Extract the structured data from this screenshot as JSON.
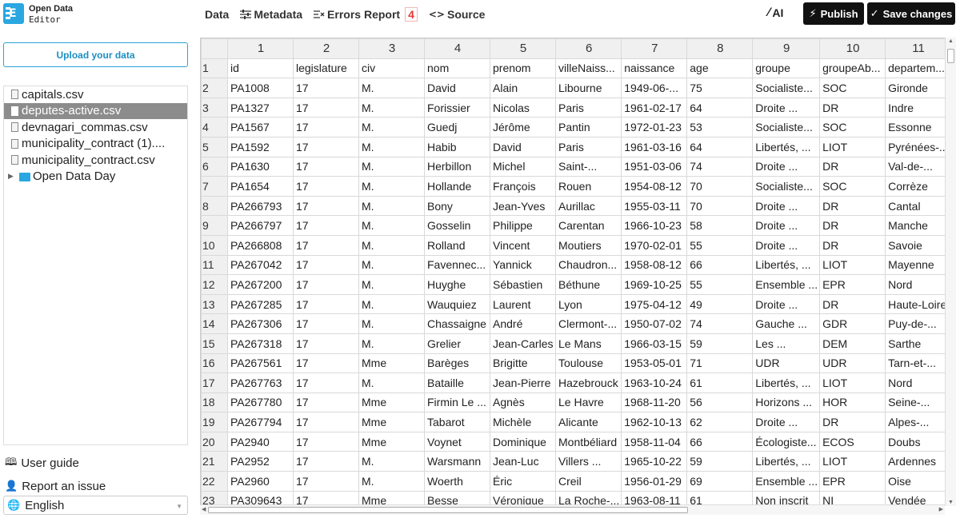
{
  "app": {
    "name_line1": "Open Data",
    "name_line2": "Editor"
  },
  "nav": {
    "data": "Data",
    "metadata": "Metadata",
    "errors_report": "Errors Report",
    "errors_count": "4",
    "source": "Source",
    "ai": "AI",
    "publish": "Publish",
    "save": "Save changes"
  },
  "sidebar": {
    "upload": "Upload your data",
    "files": [
      "capitals.csv",
      "deputes-active.csv",
      "devnagari_commas.csv",
      "municipality_contract (1)....",
      "municipality_contract.csv"
    ],
    "selected_index": 1,
    "folder": "Open Data Day",
    "user_guide": "User guide",
    "report_issue": "Report an issue",
    "language": "English"
  },
  "grid": {
    "col_numbers": [
      "1",
      "2",
      "3",
      "4",
      "5",
      "6",
      "7",
      "8",
      "9",
      "10",
      "11"
    ],
    "rows": [
      [
        "1",
        "id",
        "legislature",
        "civ",
        "nom",
        "prenom",
        "villeNaiss...",
        "naissance",
        "age",
        "groupe",
        "groupeAb...",
        "departem..."
      ],
      [
        "2",
        "PA1008",
        "17",
        "M.",
        "David",
        "Alain",
        "Libourne",
        "1949-06-...",
        "75",
        "Socialiste...",
        "SOC",
        "Gironde"
      ],
      [
        "3",
        "PA1327",
        "17",
        "M.",
        "Forissier",
        "Nicolas",
        "Paris",
        "1961-02-17",
        "64",
        "Droite ...",
        "DR",
        "Indre"
      ],
      [
        "4",
        "PA1567",
        "17",
        "M.",
        "Guedj",
        "Jérôme",
        "Pantin",
        "1972-01-23",
        "53",
        "Socialiste...",
        "SOC",
        "Essonne"
      ],
      [
        "5",
        "PA1592",
        "17",
        "M.",
        "Habib",
        "David",
        "Paris",
        "1961-03-16",
        "64",
        "Libertés, ...",
        "LIOT",
        "Pyrénées-..."
      ],
      [
        "6",
        "PA1630",
        "17",
        "M.",
        "Herbillon",
        "Michel",
        "Saint-...",
        "1951-03-06",
        "74",
        "Droite ...",
        "DR",
        "Val-de-..."
      ],
      [
        "7",
        "PA1654",
        "17",
        "M.",
        "Hollande",
        "François",
        "Rouen",
        "1954-08-12",
        "70",
        "Socialiste...",
        "SOC",
        "Corrèze"
      ],
      [
        "8",
        "PA266793",
        "17",
        "M.",
        "Bony",
        "Jean-Yves",
        "Aurillac",
        "1955-03-11",
        "70",
        "Droite ...",
        "DR",
        "Cantal"
      ],
      [
        "9",
        "PA266797",
        "17",
        "M.",
        "Gosselin",
        "Philippe",
        "Carentan",
        "1966-10-23",
        "58",
        "Droite ...",
        "DR",
        "Manche"
      ],
      [
        "10",
        "PA266808",
        "17",
        "M.",
        "Rolland",
        "Vincent",
        "Moutiers",
        "1970-02-01",
        "55",
        "Droite ...",
        "DR",
        "Savoie"
      ],
      [
        "11",
        "PA267042",
        "17",
        "M.",
        "Favennec...",
        "Yannick",
        "Chaudron...",
        "1958-08-12",
        "66",
        "Libertés, ...",
        "LIOT",
        "Mayenne"
      ],
      [
        "12",
        "PA267200",
        "17",
        "M.",
        "Huyghe",
        "Sébastien",
        "Béthune",
        "1969-10-25",
        "55",
        "Ensemble ...",
        "EPR",
        "Nord"
      ],
      [
        "13",
        "PA267285",
        "17",
        "M.",
        "Wauquiez",
        "Laurent",
        "Lyon",
        "1975-04-12",
        "49",
        "Droite ...",
        "DR",
        "Haute-Loire"
      ],
      [
        "14",
        "PA267306",
        "17",
        "M.",
        "Chassaigne",
        "André",
        "Clermont-...",
        "1950-07-02",
        "74",
        "Gauche ...",
        "GDR",
        "Puy-de-..."
      ],
      [
        "15",
        "PA267318",
        "17",
        "M.",
        "Grelier",
        "Jean-Carles",
        "Le Mans",
        "1966-03-15",
        "59",
        "Les ...",
        "DEM",
        "Sarthe"
      ],
      [
        "16",
        "PA267561",
        "17",
        "Mme",
        "Barèges",
        "Brigitte",
        "Toulouse",
        "1953-05-01",
        "71",
        "UDR",
        "UDR",
        "Tarn-et-..."
      ],
      [
        "17",
        "PA267763",
        "17",
        "M.",
        "Bataille",
        "Jean-Pierre",
        "Hazebrouck",
        "1963-10-24",
        "61",
        "Libertés, ...",
        "LIOT",
        "Nord"
      ],
      [
        "18",
        "PA267780",
        "17",
        "Mme",
        "Firmin Le ...",
        "Agnès",
        "Le Havre",
        "1968-11-20",
        "56",
        "Horizons ...",
        "HOR",
        "Seine-..."
      ],
      [
        "19",
        "PA267794",
        "17",
        "Mme",
        "Tabarot",
        "Michèle",
        "Alicante",
        "1962-10-13",
        "62",
        "Droite ...",
        "DR",
        "Alpes-..."
      ],
      [
        "20",
        "PA2940",
        "17",
        "Mme",
        "Voynet",
        "Dominique",
        "Montbéliard",
        "1958-11-04",
        "66",
        "Écologiste...",
        "ECOS",
        "Doubs"
      ],
      [
        "21",
        "PA2952",
        "17",
        "M.",
        "Warsmann",
        "Jean-Luc",
        "Villers ...",
        "1965-10-22",
        "59",
        "Libertés, ...",
        "LIOT",
        "Ardennes"
      ],
      [
        "22",
        "PA2960",
        "17",
        "M.",
        "Woerth",
        "Éric",
        "Creil",
        "1956-01-29",
        "69",
        "Ensemble ...",
        "EPR",
        "Oise"
      ],
      [
        "23",
        "PA309643",
        "17",
        "Mme",
        "Besse",
        "Véronique",
        "La Roche-...",
        "1963-08-11",
        "61",
        "Non inscrit",
        "NI",
        "Vendée"
      ]
    ]
  }
}
